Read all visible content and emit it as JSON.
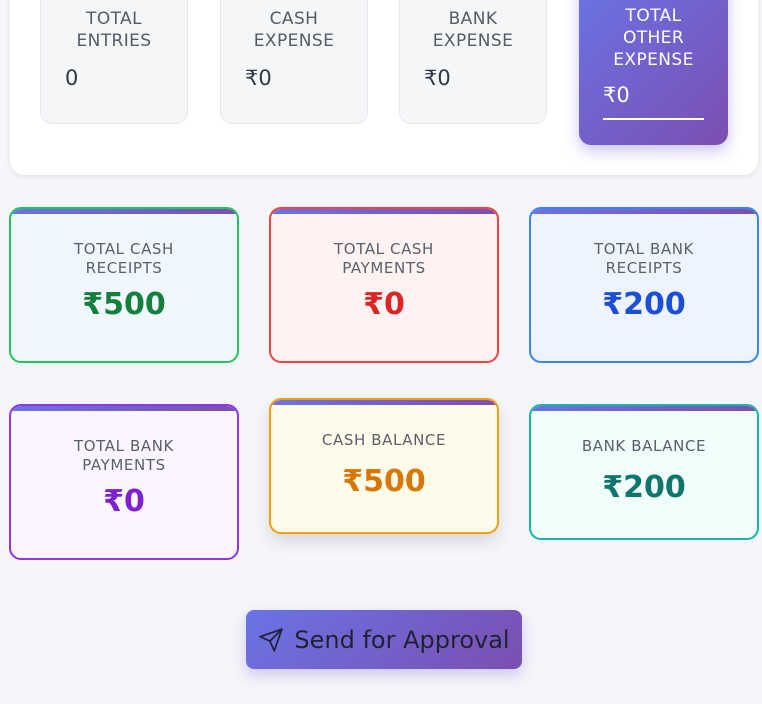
{
  "summary": {
    "total_entries": {
      "label": "TOTAL ENTRIES",
      "value": "0"
    },
    "cash_expense": {
      "label": "CASH EXPENSE",
      "value": "₹0"
    },
    "bank_expense": {
      "label": "BANK EXPENSE",
      "value": "₹0"
    },
    "total_other_expense": {
      "label": "TOTAL OTHER EXPENSE",
      "value": "₹0"
    }
  },
  "metrics": {
    "total_cash_receipts": {
      "label": "TOTAL CASH RECEIPTS",
      "value": "₹500",
      "color": "#15803d",
      "border": "#22c55e",
      "bg": "#f0f7ff"
    },
    "total_cash_payments": {
      "label": "TOTAL CASH PAYMENTS",
      "value": "₹0",
      "color": "#dc2626",
      "border": "#ef4444",
      "bg": "#fff2f2"
    },
    "total_bank_receipts": {
      "label": "TOTAL BANK RECEIPTS",
      "value": "₹200",
      "color": "#1d4ed8",
      "border": "#3b82f6",
      "bg": "#eef4ff"
    },
    "total_bank_payments": {
      "label": "TOTAL BANK PAYMENTS",
      "value": "₹0",
      "color": "#7e22ce",
      "border": "#9333ea",
      "bg": "#faf5ff"
    },
    "cash_balance": {
      "label": "CASH BALANCE",
      "value": "₹500",
      "color": "#d97706",
      "border": "#f59e0b",
      "bg": "#fffbeb"
    },
    "bank_balance": {
      "label": "BANK BALANCE",
      "value": "₹200",
      "color": "#0f766e",
      "border": "#14b8a6",
      "bg": "#f0fdfa"
    }
  },
  "actions": {
    "send_for_approval": {
      "label": "Send for Approval",
      "icon": "send-icon"
    }
  },
  "colors": {
    "accent_gradient_start": "#6a73e6",
    "accent_gradient_end": "#7b4fb0"
  }
}
